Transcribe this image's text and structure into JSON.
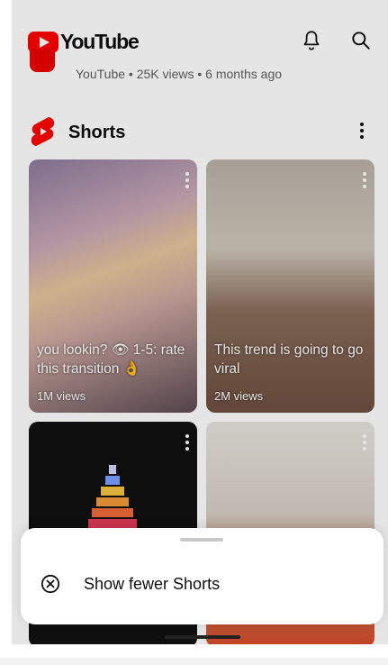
{
  "app": {
    "logo_text": "YouTube"
  },
  "header": {
    "icons": [
      "bell-icon",
      "search-icon"
    ]
  },
  "previous_video": {
    "meta": "YouTube • 25K views • 6 months ago"
  },
  "shorts_section": {
    "title": "Shorts",
    "cards": [
      {
        "title": "you lookin? 👁 1-5: rate this transition 👌",
        "views": "1M views"
      },
      {
        "title": "This trend is going to go viral",
        "views": "2M views"
      },
      {
        "title": "",
        "views": ""
      },
      {
        "title": "",
        "views": ""
      }
    ]
  },
  "bottom_sheet": {
    "items": [
      {
        "label": "Show fewer Shorts",
        "icon": "close-circle-icon"
      }
    ]
  },
  "colors": {
    "brand": "#ff0000",
    "text": "#0f0f0f",
    "secondary_text": "#606060"
  }
}
